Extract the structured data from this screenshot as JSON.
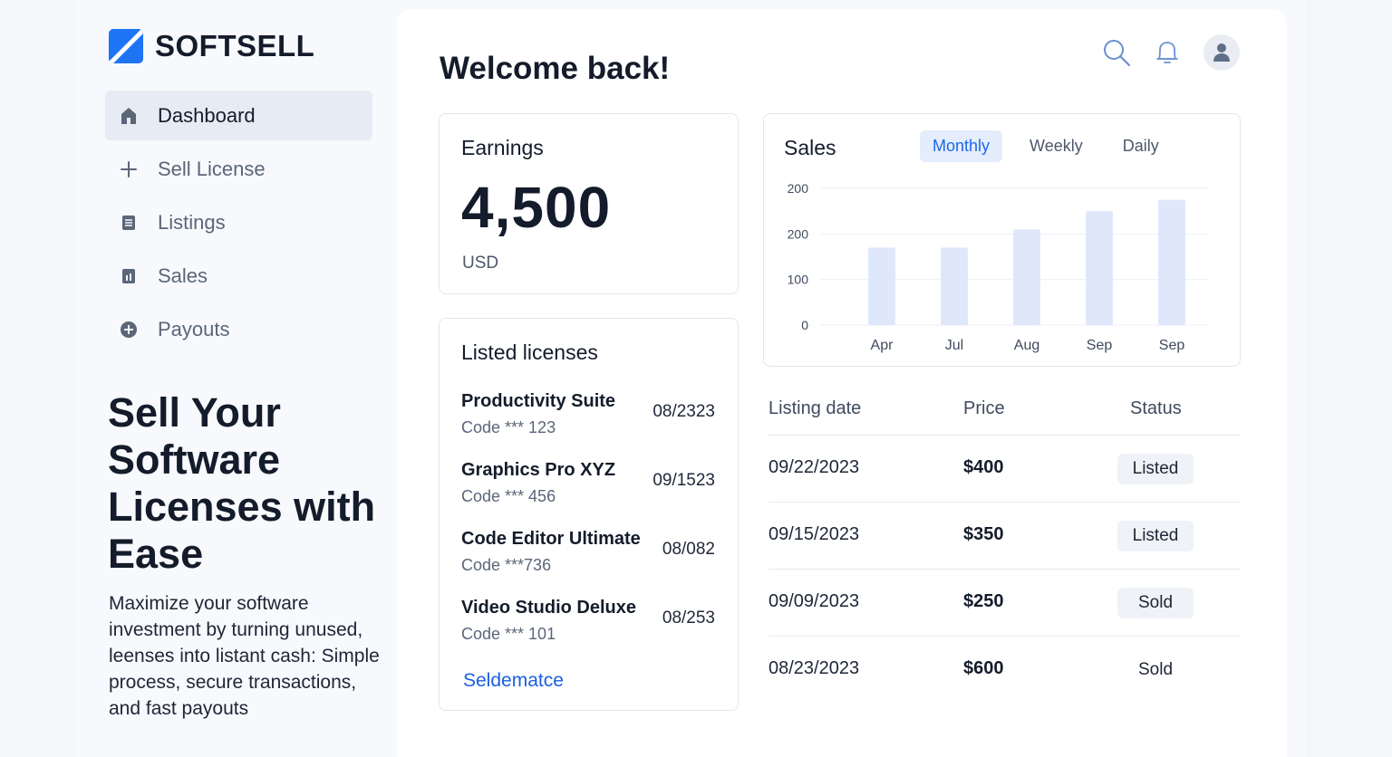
{
  "brand": {
    "name": "SOFTSELL",
    "accent": "#1d74f5"
  },
  "nav": {
    "items": [
      {
        "label": "Dashboard",
        "icon": "home-icon",
        "active": true
      },
      {
        "label": "Sell License",
        "icon": "plus-icon",
        "active": false
      },
      {
        "label": "Listings",
        "icon": "document-icon",
        "active": false
      },
      {
        "label": "Sales",
        "icon": "bar-chart-icon",
        "active": false
      },
      {
        "label": "Payouts",
        "icon": "plus-circle-icon",
        "active": false
      }
    ]
  },
  "hero": {
    "title": "Sell Your Software Licenses with Ease",
    "description": "Maximize your software investment by turning unused, leenses into listant cash: Simple process, secure transactions, and fast payouts"
  },
  "header": {
    "welcome": "Welcome back!",
    "icons": [
      "search-icon",
      "bell-icon",
      "user-avatar-icon"
    ]
  },
  "earnings": {
    "title": "Earnings",
    "value": "4,500",
    "unit": "USD"
  },
  "licenses": {
    "title": "Listed licenses",
    "items": [
      {
        "name": "Productivity Suite",
        "code": "Code *** 123",
        "date": "08/2323"
      },
      {
        "name": "Graphics Pro XYZ",
        "code": "Code *** 456",
        "date": "09/1523"
      },
      {
        "name": "Code Editor Ultimate",
        "code": "Code ***736",
        "date": "08/082"
      },
      {
        "name": "Video Studio Deluxe",
        "code": "Code *** 101",
        "date": "08/253"
      }
    ],
    "link_label": "Seldematce"
  },
  "sales": {
    "title": "Sales",
    "tabs": [
      {
        "label": "Monthly",
        "active": true
      },
      {
        "label": "Weekly",
        "active": false
      },
      {
        "label": "Daily",
        "active": false
      }
    ]
  },
  "chart_data": {
    "type": "bar",
    "categories": [
      "Apr",
      "Jul",
      "Aug",
      "Sep",
      "Sep"
    ],
    "values": [
      170,
      170,
      210,
      250,
      275
    ],
    "ytick_labels": [
      "0",
      "100",
      "200",
      "200"
    ],
    "ytick_values": [
      0,
      100,
      200,
      300
    ],
    "ylim": [
      0,
      300
    ],
    "grid": true,
    "bar_color": "#dfe8fb"
  },
  "table": {
    "headers": {
      "date": "Listing date",
      "price": "Price",
      "status": "Status"
    },
    "rows": [
      {
        "date": "09/22/2023",
        "price": "$400",
        "status": "Listed",
        "badge": true
      },
      {
        "date": "09/15/2023",
        "price": "$350",
        "status": "Listed",
        "badge": true
      },
      {
        "date": "09/09/2023",
        "price": "$250",
        "status": "Sold",
        "badge": true
      },
      {
        "date": "08/23/2023",
        "price": "$600",
        "status": "Sold",
        "badge": false
      }
    ]
  }
}
